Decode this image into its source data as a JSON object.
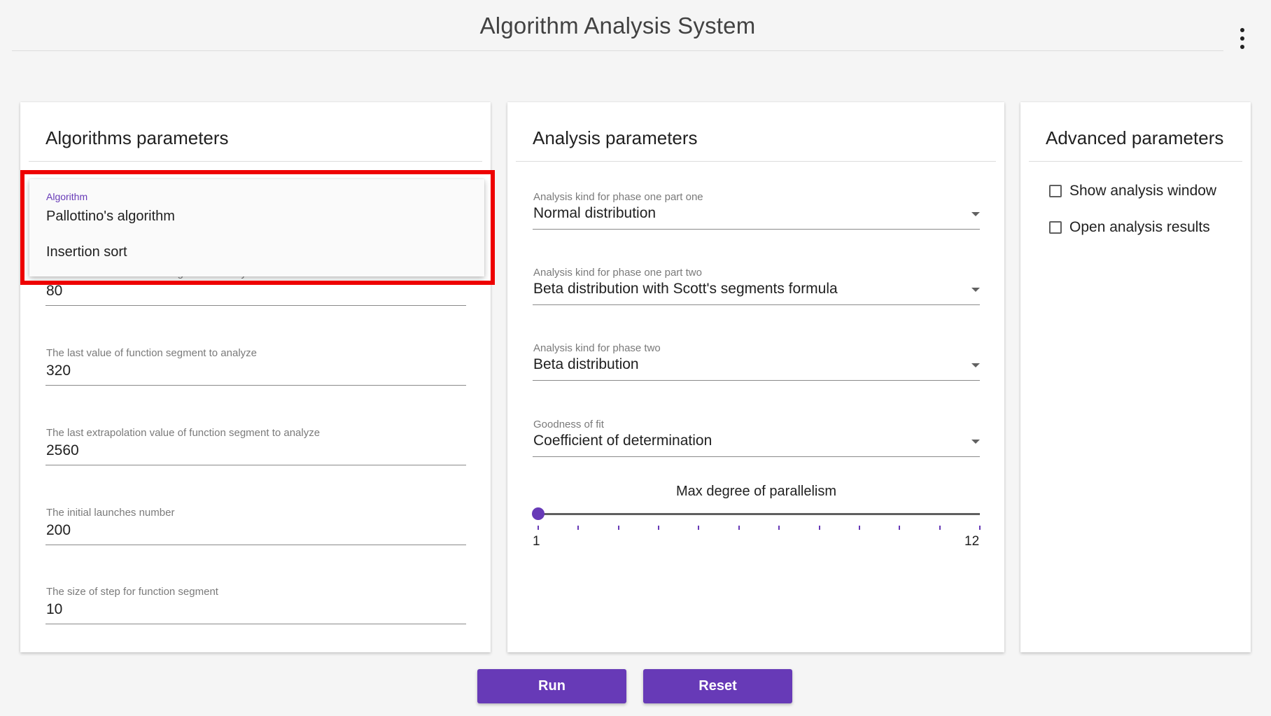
{
  "header": {
    "title": "Algorithm Analysis System",
    "menu_icon": "more-vertical-icon"
  },
  "algorithms_card": {
    "title": "Algorithms parameters",
    "algorithm_select": {
      "label": "Algorithm",
      "options": [
        "Pallottino's algorithm",
        "Insertion sort"
      ]
    },
    "fields": [
      {
        "label": "The first value of function segment to analyze",
        "value": "80"
      },
      {
        "label": "The last value of function segment to analyze",
        "value": "320"
      },
      {
        "label": "The last extrapolation value of function segment to analyze",
        "value": "2560"
      },
      {
        "label": "The initial launches number",
        "value": "200"
      },
      {
        "label": "The size of step for function segment",
        "value": "10"
      }
    ]
  },
  "analysis_card": {
    "title": "Analysis parameters",
    "selects": [
      {
        "label": "Analysis kind for phase one part one",
        "value": "Normal distribution"
      },
      {
        "label": "Analysis kind for phase one part two",
        "value": "Beta distribution with Scott's segments formula"
      },
      {
        "label": "Analysis kind for phase two",
        "value": "Beta distribution"
      },
      {
        "label": "Goodness of fit",
        "value": "Coefficient of determination"
      }
    ],
    "slider": {
      "label": "Max degree of parallelism",
      "min": 1,
      "max": 12,
      "value": 1,
      "min_label": "1",
      "max_label": "12"
    }
  },
  "advanced_card": {
    "title": "Advanced parameters",
    "checkboxes": [
      {
        "label": "Show analysis window",
        "checked": false
      },
      {
        "label": "Open analysis results",
        "checked": false
      }
    ]
  },
  "actions": {
    "run_label": "Run",
    "reset_label": "Reset"
  },
  "colors": {
    "accent": "#673ab7",
    "highlight": "#ee0000",
    "background": "#f5f5f5"
  }
}
